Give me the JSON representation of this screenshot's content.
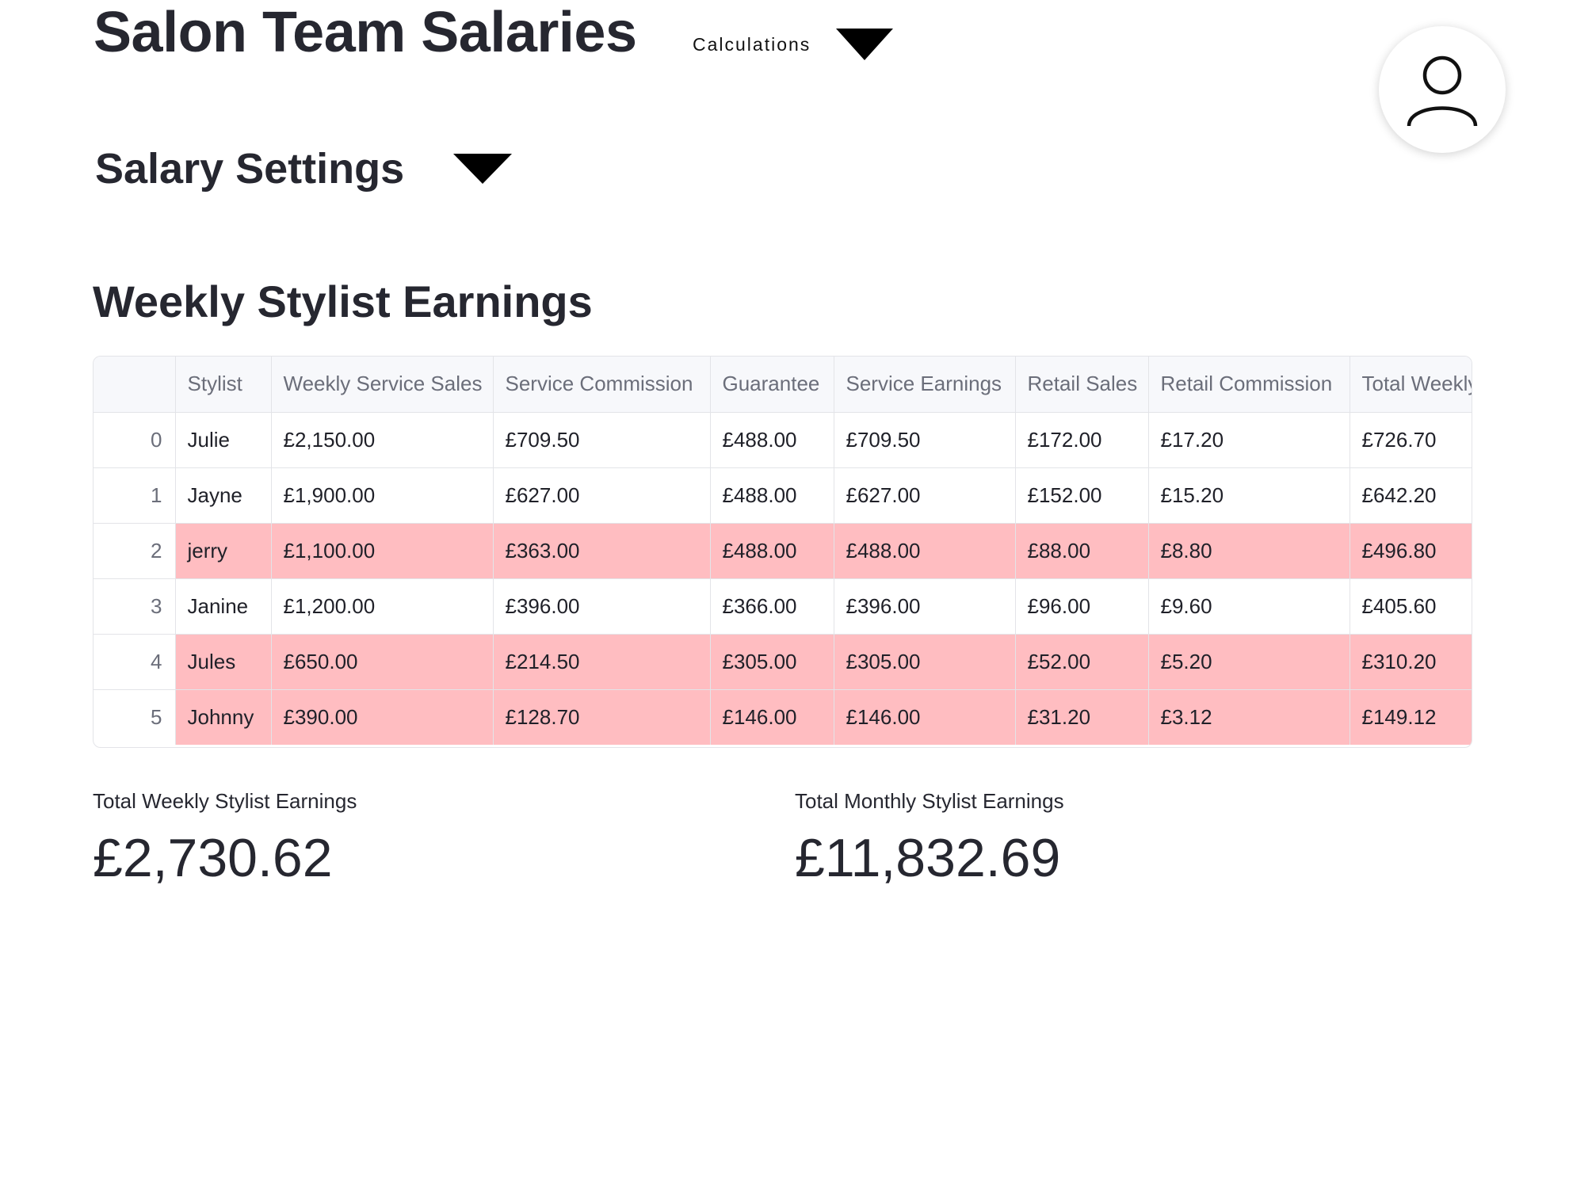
{
  "app": {
    "title": "Salon Team Salaries",
    "calculations_label": "Calculations"
  },
  "icons": {
    "user": "user-icon",
    "dropdown": "triangle-down-icon"
  },
  "settings": {
    "label": "Salary Settings"
  },
  "earnings_table": {
    "title": "Weekly Stylist Earnings",
    "columns": [
      "",
      "Stylist",
      "Weekly Service Sales",
      "Service Commission",
      "Guarantee",
      "Service Earnings",
      "Retail Sales",
      "Retail Commission",
      "Total Weekly"
    ],
    "rows": [
      {
        "index": "0",
        "cells": [
          "Julie",
          "£2,150.00",
          "£709.50",
          "£488.00",
          "£709.50",
          "£172.00",
          "£17.20",
          "£726.70"
        ],
        "highlighted": false
      },
      {
        "index": "1",
        "cells": [
          "Jayne",
          "£1,900.00",
          "£627.00",
          "£488.00",
          "£627.00",
          "£152.00",
          "£15.20",
          "£642.20"
        ],
        "highlighted": false
      },
      {
        "index": "2",
        "cells": [
          "jerry",
          "£1,100.00",
          "£363.00",
          "£488.00",
          "£488.00",
          "£88.00",
          "£8.80",
          "£496.80"
        ],
        "highlighted": true
      },
      {
        "index": "3",
        "cells": [
          "Janine",
          "£1,200.00",
          "£396.00",
          "£366.00",
          "£396.00",
          "£96.00",
          "£9.60",
          "£405.60"
        ],
        "highlighted": false
      },
      {
        "index": "4",
        "cells": [
          "Jules",
          "£650.00",
          "£214.50",
          "£305.00",
          "£305.00",
          "£52.00",
          "£5.20",
          "£310.20"
        ],
        "highlighted": true
      },
      {
        "index": "5",
        "cells": [
          "Johnny",
          "£390.00",
          "£128.70",
          "£146.00",
          "£146.00",
          "£31.20",
          "£3.12",
          "£149.12"
        ],
        "highlighted": true
      }
    ],
    "highlight_color": "#ffbdc1"
  },
  "metrics": {
    "weekly_label": "Total Weekly Stylist Earnings",
    "weekly_value": "£2,730.62",
    "monthly_label": "Total Monthly Stylist Earnings",
    "monthly_value": "£11,832.69"
  }
}
